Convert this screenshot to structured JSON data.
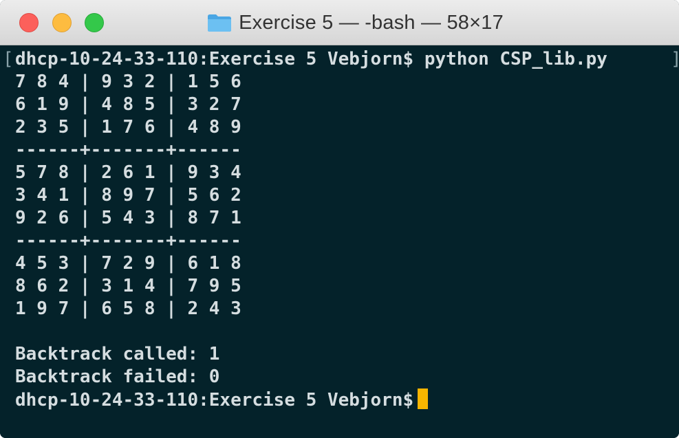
{
  "window": {
    "title": "Exercise 5 — -bash — 58×17"
  },
  "terminal": {
    "lines": [
      "dhcp-10-24-33-110:Exercise 5 Vebjorn$ python CSP_lib.py",
      "7 8 4 | 9 3 2 | 1 5 6",
      "6 1 9 | 4 8 5 | 3 2 7",
      "2 3 5 | 1 7 6 | 4 8 9",
      "------+-------+------",
      "5 7 8 | 2 6 1 | 9 3 4",
      "3 4 1 | 8 9 7 | 5 6 2",
      "9 2 6 | 5 4 3 | 8 7 1",
      "------+-------+------",
      "4 5 3 | 7 2 9 | 6 1 8",
      "8 6 2 | 3 1 4 | 7 9 5",
      "1 9 7 | 6 5 8 | 2 4 3",
      "",
      "Backtrack called: 1",
      "Backtrack failed: 0",
      "dhcp-10-24-33-110:Exercise 5 Vebjorn$"
    ],
    "left_bracket": "[",
    "right_bracket": "]"
  },
  "colors": {
    "background": "#04222a",
    "text": "#d5dde0",
    "cursor": "#f7b500",
    "close": "#fc605b",
    "minimize": "#fdbc40",
    "zoom": "#34c84a",
    "folder": "#5eb3ea"
  },
  "icons": {
    "folder": "folder-icon"
  }
}
